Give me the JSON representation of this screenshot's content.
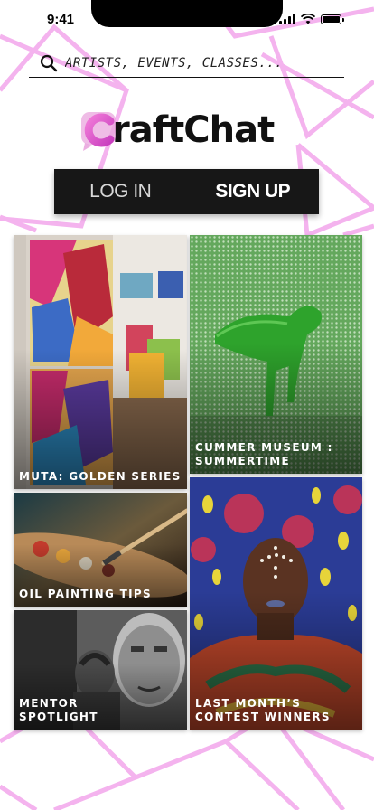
{
  "status_bar": {
    "time": "9:41",
    "icons": [
      "cellular-signal-icon",
      "wifi-icon",
      "battery-icon"
    ]
  },
  "search": {
    "placeholder": "ARTISTS, EVENTS, CLASSES...",
    "icon": "search-icon"
  },
  "logo": {
    "text": "raftChat",
    "letter": "C",
    "accent_color": "#e055c8"
  },
  "auth": {
    "login_label": "LOG IN",
    "signup_label": "SIGN UP"
  },
  "tiles": [
    {
      "caption": "MUTA: GOLDEN SERIES",
      "image": "gallery-cubist-paintings"
    },
    {
      "caption": "CUMMER MUSEUM :\nSUMMERTIME",
      "image": "green-sculpture-figure"
    },
    {
      "caption": "OIL PAINTING TIPS",
      "image": "paint-palette-brush"
    },
    {
      "caption": "LAST MONTH’S\nCONTEST WINNERS",
      "image": "portrait-face-paint"
    },
    {
      "caption": "MENTOR\nSPOTLIGHT",
      "image": "street-mural-portrait"
    }
  ],
  "colors": {
    "background_lines": "#f3a6ec",
    "auth_bar": "#171717",
    "text": "#111111"
  }
}
